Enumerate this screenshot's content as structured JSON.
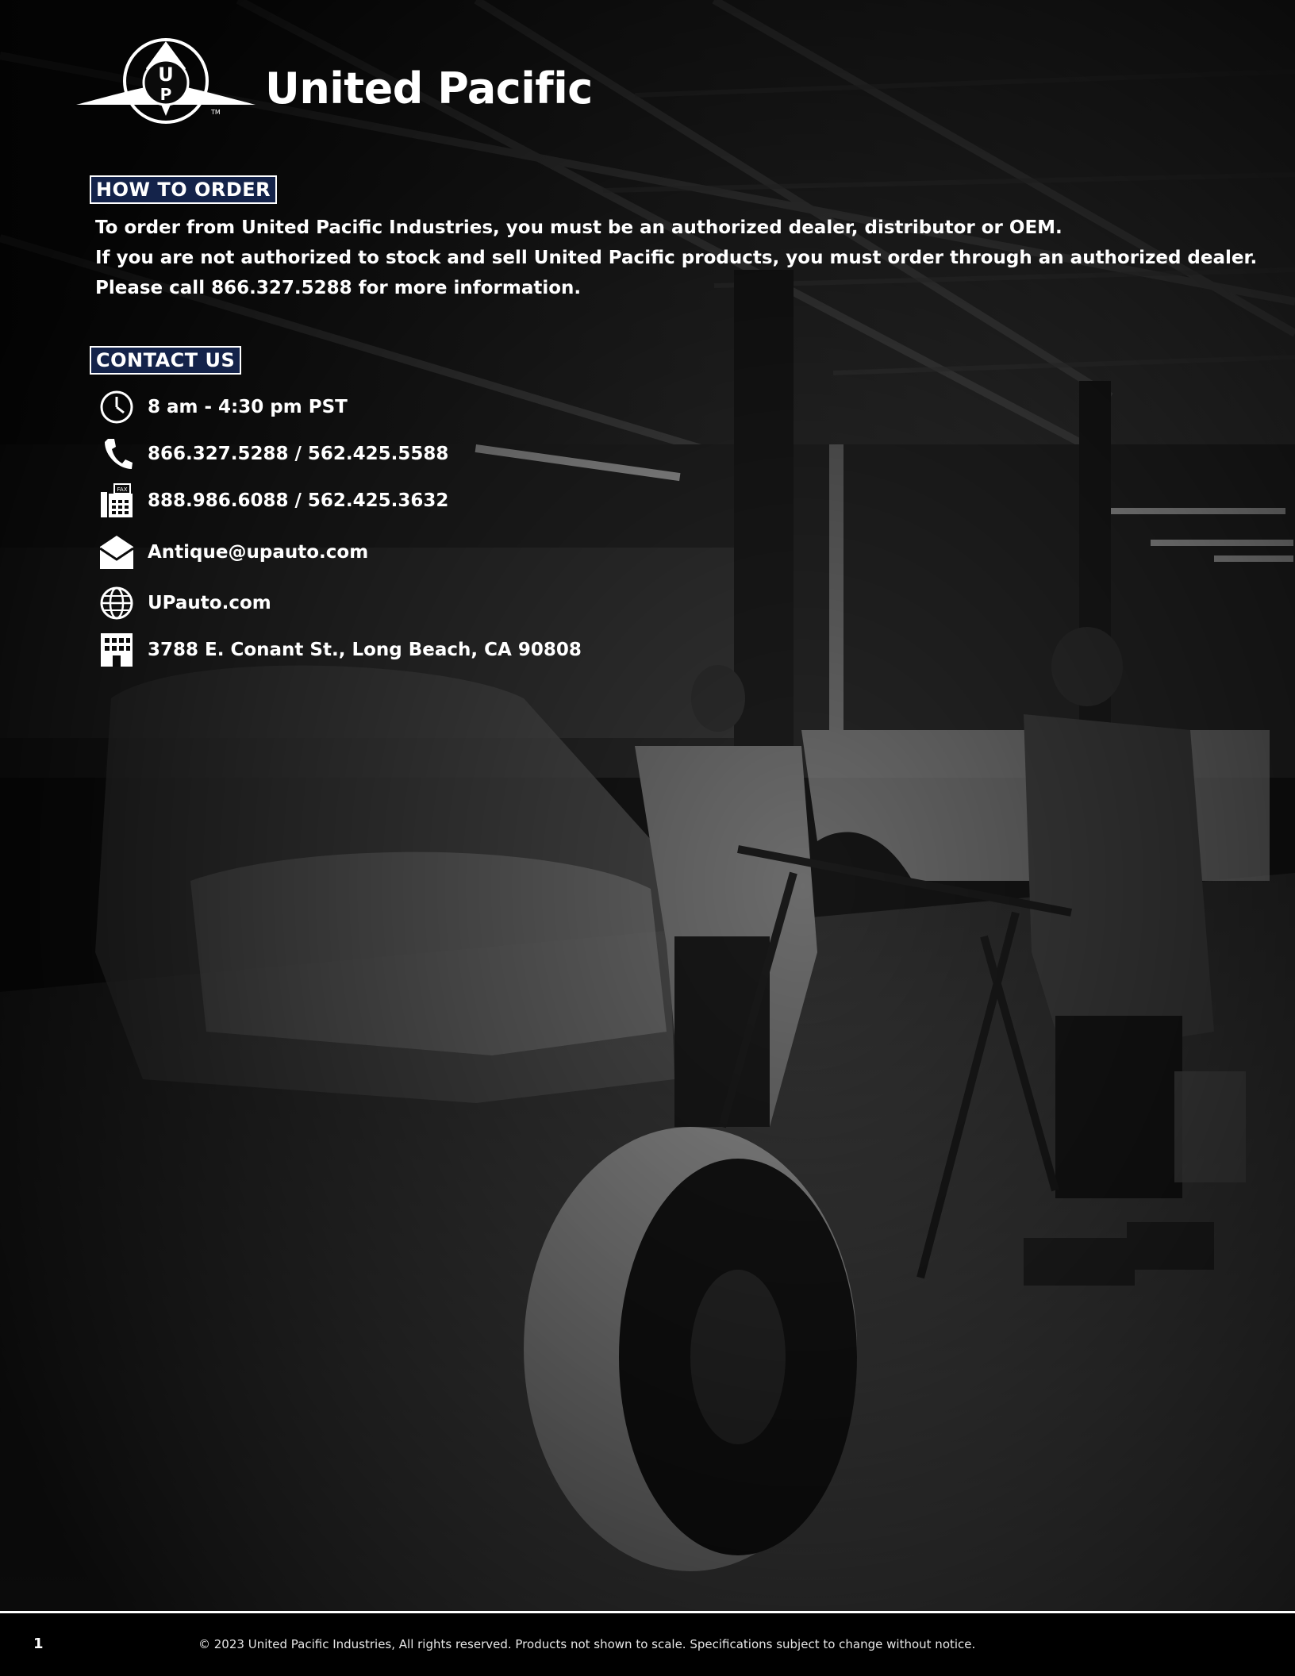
{
  "brand": {
    "name": "United Pacific",
    "logo_letters": "UP",
    "trademark": "TM"
  },
  "how_to_order": {
    "heading": "HOW TO ORDER",
    "lines": [
      "To order from United Pacific Industries, you must be an authorized dealer, distributor or OEM.",
      "If you are not authorized to stock and sell United Pacific products, you must order through an authorized dealer.",
      "Please call 866.327.5288 for more information."
    ]
  },
  "contact_us": {
    "heading": "CONTACT US",
    "items": [
      {
        "icon": "clock-icon",
        "text": "8 am - 4:30 pm PST"
      },
      {
        "icon": "phone-icon",
        "text": "866.327.5288 / 562.425.5588"
      },
      {
        "icon": "fax-icon",
        "text": "888.986.6088 / 562.425.3632",
        "icon_label": "FAX"
      },
      {
        "icon": "envelope-icon",
        "text": "Antique@upauto.com"
      },
      {
        "icon": "globe-icon",
        "text": "UPauto.com"
      },
      {
        "icon": "building-icon",
        "text": "3788 E. Conant St., Long Beach, CA 90808"
      }
    ]
  },
  "footer": {
    "page_number": "1",
    "copyright": "© 2023 United Pacific Industries, All rights reserved. Products not shown to scale.  Specifications subject to change without notice."
  },
  "colors": {
    "badge_bg": "#14234a",
    "background": "#0b0b0b",
    "text": "#ffffff"
  }
}
